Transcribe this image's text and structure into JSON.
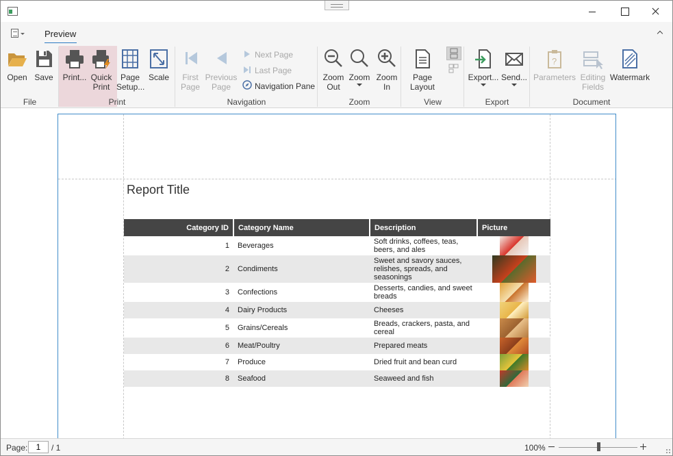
{
  "window": {
    "tabs": [
      {
        "label": "Preview",
        "active": true
      }
    ]
  },
  "ribbon": {
    "groups": {
      "file": {
        "label": "File",
        "buttons": [
          {
            "label": "Open",
            "icon": "folder-open-icon"
          },
          {
            "label": "Save",
            "icon": "save-icon"
          }
        ]
      },
      "print": {
        "label": "Print",
        "buttons": [
          {
            "label": "Print...",
            "icon": "printer-icon"
          },
          {
            "line1": "Quick",
            "line2": "Print",
            "icon": "quick-print-icon"
          },
          {
            "line1": "Page",
            "line2": "Setup...",
            "icon": "page-setup-icon"
          },
          {
            "label": "Scale",
            "icon": "scale-icon"
          }
        ]
      },
      "navigation": {
        "label": "Navigation",
        "first_page": {
          "line1": "First",
          "line2": "Page"
        },
        "previous_page": {
          "line1": "Previous",
          "line2": "Page"
        },
        "next_page": "Next Page",
        "last_page": "Last Page",
        "navigation_pane": "Navigation Pane"
      },
      "zoom": {
        "label": "Zoom",
        "zoom_out": {
          "line1": "Zoom",
          "line2": "Out"
        },
        "zoom": {
          "label": "Zoom"
        },
        "zoom_in": {
          "line1": "Zoom",
          "line2": "In"
        }
      },
      "view": {
        "label": "View",
        "page_layout": {
          "line1": "Page",
          "line2": "Layout"
        }
      },
      "export": {
        "label": "Export",
        "export": "Export...",
        "send": "Send..."
      },
      "document": {
        "label": "Document",
        "parameters": "Parameters",
        "editing_fields": {
          "line1": "Editing",
          "line2": "Fields"
        },
        "watermark": "Watermark"
      }
    }
  },
  "report": {
    "title": "Report Title",
    "columns": [
      "Category ID",
      "Category Name",
      "Description",
      "Picture"
    ],
    "rows": [
      {
        "id": "1",
        "name": "Beverages",
        "description": "Soft drinks, coffees, teas, beers, and ales",
        "picture": "beverages-picture"
      },
      {
        "id": "2",
        "name": "Condiments",
        "description": "Sweet and savory sauces, relishes, spreads, and seasonings",
        "picture": "condiments-picture"
      },
      {
        "id": "3",
        "name": "Confections",
        "description": "Desserts, candies, and sweet breads",
        "picture": "confections-picture"
      },
      {
        "id": "4",
        "name": "Dairy Products",
        "description": "Cheeses",
        "picture": "dairy-picture"
      },
      {
        "id": "5",
        "name": "Grains/Cereals",
        "description": "Breads, crackers, pasta, and cereal",
        "picture": "grains-picture"
      },
      {
        "id": "6",
        "name": "Meat/Poultry",
        "description": "Prepared meats",
        "picture": "meat-picture"
      },
      {
        "id": "7",
        "name": "Produce",
        "description": "Dried fruit and bean curd",
        "picture": "produce-picture"
      },
      {
        "id": "8",
        "name": "Seafood",
        "description": "Seaweed and fish",
        "picture": "seafood-picture"
      }
    ]
  },
  "status": {
    "page_label": "Page:",
    "page_value": "1",
    "page_total": "/ 1",
    "zoom": "100%",
    "zoom_fraction": 0.5
  },
  "colors": {
    "accent": "#2b79c2",
    "print_group_highlight": "#ecd7db",
    "table_header": "#454545",
    "alt_row": "#e8e8e8"
  }
}
